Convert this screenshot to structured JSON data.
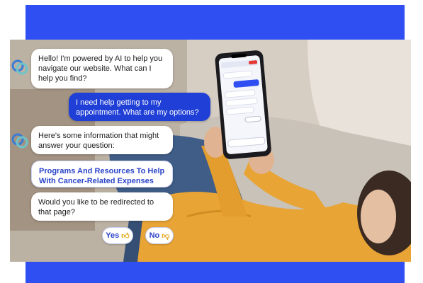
{
  "colors": {
    "accent": "#2f4ff2",
    "user_bubble": "#1f3fd6",
    "link_text": "#2b44c9",
    "sweater": "#e9a436"
  },
  "chat": {
    "bot_greeting": "Hello! I'm powered by AI to help you navigate our website. What can I help you find?",
    "user_message": "I need help getting to my appointment. What are my options?",
    "bot_info": "Here's some information that might answer your question:",
    "link_text": "Programs And Resources To Help With Cancer-Related Expenses",
    "bot_redirect": "Would you like to be redirected to that page?",
    "yes_label": "Yes",
    "no_label": "No",
    "yes_icon": "thumbs-up-icon",
    "no_icon": "thumbs-down-icon",
    "avatar_icon": "chatbot-logo-icon"
  }
}
